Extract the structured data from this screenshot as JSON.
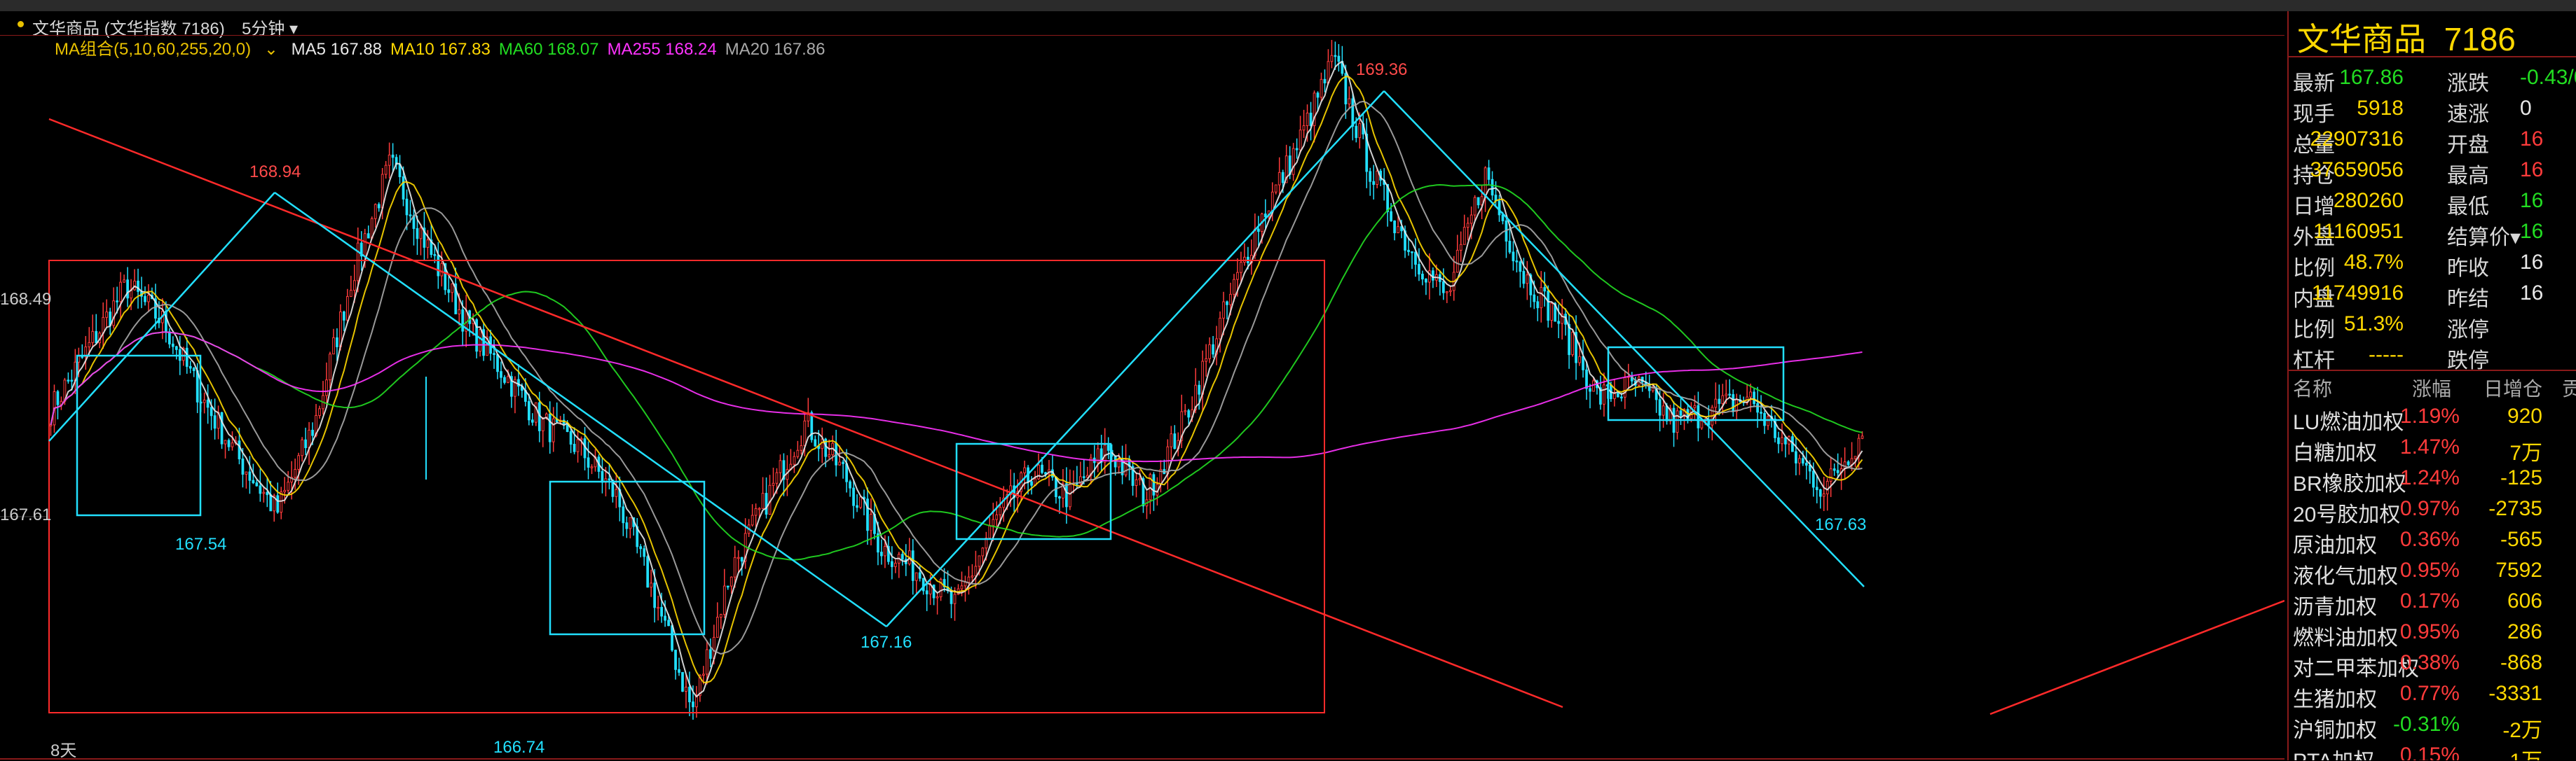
{
  "header": {
    "title": "文华商品 (文华指数 7186)",
    "period": "5分钟"
  },
  "ma_bar": {
    "group": "MA组合(5,10,60,255,20,0)",
    "items": [
      {
        "label": "MA5 167.88",
        "color": "#e8e8e8"
      },
      {
        "label": "MA10 167.83",
        "color": "#ffd800"
      },
      {
        "label": "MA60 168.07",
        "color": "#22dd22"
      },
      {
        "label": "MA255 168.24",
        "color": "#ff33ff"
      },
      {
        "label": "MA20 167.86",
        "color": "#aaaaaa"
      }
    ]
  },
  "price_axis": {
    "upper": "168.49",
    "lower": "167.61"
  },
  "annotations": {
    "high1": "168.94",
    "high2": "169.36",
    "low1": "167.54",
    "low2": "166.74",
    "low3": "167.16",
    "low4": "167.63",
    "days": "8天"
  },
  "chart_data": {
    "type": "candlestick",
    "timeframe": "5分钟",
    "ylim": [
      166.7,
      169.4
    ],
    "close_points": [
      167.95,
      168.2,
      168.45,
      168.3,
      168.0,
      167.75,
      167.54,
      167.9,
      168.5,
      168.94,
      168.6,
      168.3,
      168.1,
      167.9,
      167.8,
      167.6,
      167.2,
      166.74,
      167.3,
      167.6,
      167.9,
      167.7,
      167.4,
      167.3,
      167.16,
      167.5,
      167.7,
      167.6,
      167.8,
      167.6,
      167.9,
      168.3,
      168.7,
      169.0,
      169.36,
      168.9,
      168.6,
      168.4,
      168.9,
      168.5,
      168.3,
      168.0,
      168.05,
      167.9,
      167.95,
      168.0,
      167.8,
      167.63,
      167.86
    ]
  },
  "panel": {
    "name": "文华商品",
    "code": "7186",
    "quote": [
      {
        "l": "最新",
        "v": "167.86",
        "vc": "grn",
        "l2": "涨跌",
        "v2": "-0.43/0.",
        "v2c": "grn"
      },
      {
        "l": "现手",
        "v": "5918",
        "vc": "yel",
        "l2": "速涨",
        "v2": "0",
        "v2c": "wht"
      },
      {
        "l": "总量",
        "v": "22907316",
        "vc": "yel",
        "l2": "开盘",
        "v2": "16",
        "v2c": "red"
      },
      {
        "l": "持仓",
        "v": "37659056",
        "vc": "yel",
        "l2": "最高",
        "v2": "16",
        "v2c": "red"
      },
      {
        "l": "日增",
        "v": "280260",
        "vc": "yel",
        "l2": "最低",
        "v2": "16",
        "v2c": "grn"
      },
      {
        "l": "外盘",
        "v": "11160951",
        "vc": "yel",
        "l2": "结算价▾",
        "v2": "16",
        "v2c": "grn"
      },
      {
        "l": "比例",
        "v": "48.7%",
        "vc": "yel",
        "l2": "昨收",
        "v2": "16",
        "v2c": "wht"
      },
      {
        "l": "内盘",
        "v": "11749916",
        "vc": "yel",
        "l2": "昨结",
        "v2": "16",
        "v2c": "wht"
      },
      {
        "l": "比例",
        "v": "51.3%",
        "vc": "yel",
        "l2": "涨停",
        "v2": "",
        "v2c": "wht"
      },
      {
        "l": "杠杆",
        "v": "-----",
        "vc": "yel",
        "l2": "跌停",
        "v2": "",
        "v2c": "wht"
      }
    ],
    "watch_headers": [
      "名称",
      "涨幅",
      "日增仓",
      "贡"
    ],
    "watch": [
      {
        "n": "LU燃油加权",
        "p": "1.19%",
        "pc": "red",
        "d": "920"
      },
      {
        "n": "白糖加权",
        "p": "1.47%",
        "pc": "red",
        "d": "7万"
      },
      {
        "n": "BR橡胶加权",
        "p": "1.24%",
        "pc": "red",
        "d": "-125"
      },
      {
        "n": "20号胶加权",
        "p": "0.97%",
        "pc": "red",
        "d": "-2735"
      },
      {
        "n": "原油加权",
        "p": "0.36%",
        "pc": "red",
        "d": "-565"
      },
      {
        "n": "液化气加权",
        "p": "0.95%",
        "pc": "red",
        "d": "7592"
      },
      {
        "n": "沥青加权",
        "p": "0.17%",
        "pc": "red",
        "d": "606"
      },
      {
        "n": "燃料油加权",
        "p": "0.95%",
        "pc": "red",
        "d": "286"
      },
      {
        "n": "对二甲苯加权",
        "p": "0.38%",
        "pc": "red",
        "d": "-868"
      },
      {
        "n": "生猪加权",
        "p": "0.77%",
        "pc": "red",
        "d": "-3331"
      },
      {
        "n": "沪铜加权",
        "p": "-0.31%",
        "pc": "grn",
        "d": "-2万"
      },
      {
        "n": "PTA加权",
        "p": "0.15%",
        "pc": "red",
        "d": "1万"
      }
    ]
  }
}
